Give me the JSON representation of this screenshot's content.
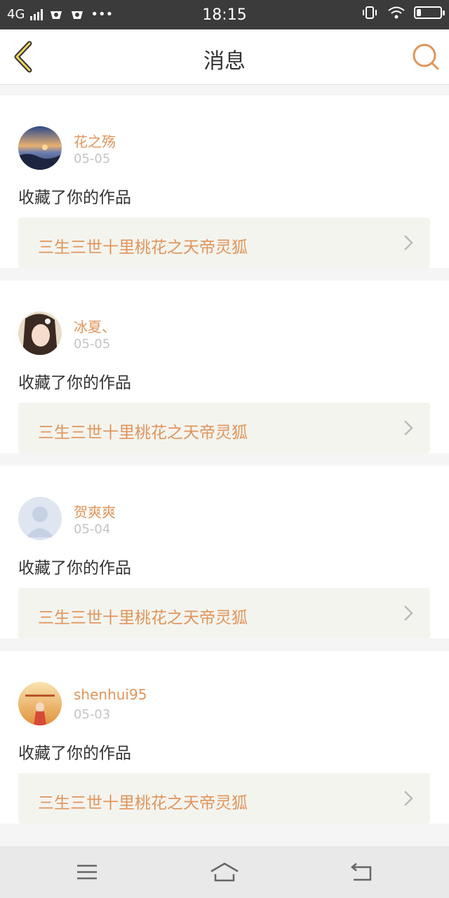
{
  "status_bar": {
    "network": "4G",
    "time": "18:15"
  },
  "nav": {
    "title": "消息"
  },
  "accent_color": "#e0955a",
  "messages": [
    {
      "name": "花之殇",
      "date": "05-05",
      "action": "收藏了你的作品",
      "work": "三生三世十里桃花之天帝灵狐",
      "avatar": "sunset-photo"
    },
    {
      "name": "冰夏、",
      "date": "05-05",
      "action": "收藏了你的作品",
      "work": "三生三世十里桃花之天帝灵狐",
      "avatar": "girl-portrait"
    },
    {
      "name": "贺爽爽",
      "date": "05-04",
      "action": "收藏了你的作品",
      "work": "三生三世十里桃花之天帝灵狐",
      "avatar": "default-person"
    },
    {
      "name": "shenhui95",
      "date": "05-03",
      "action": "收藏了你的作品",
      "work": "三生三世十里桃花之天帝灵狐",
      "avatar": "autumn-poster"
    }
  ]
}
